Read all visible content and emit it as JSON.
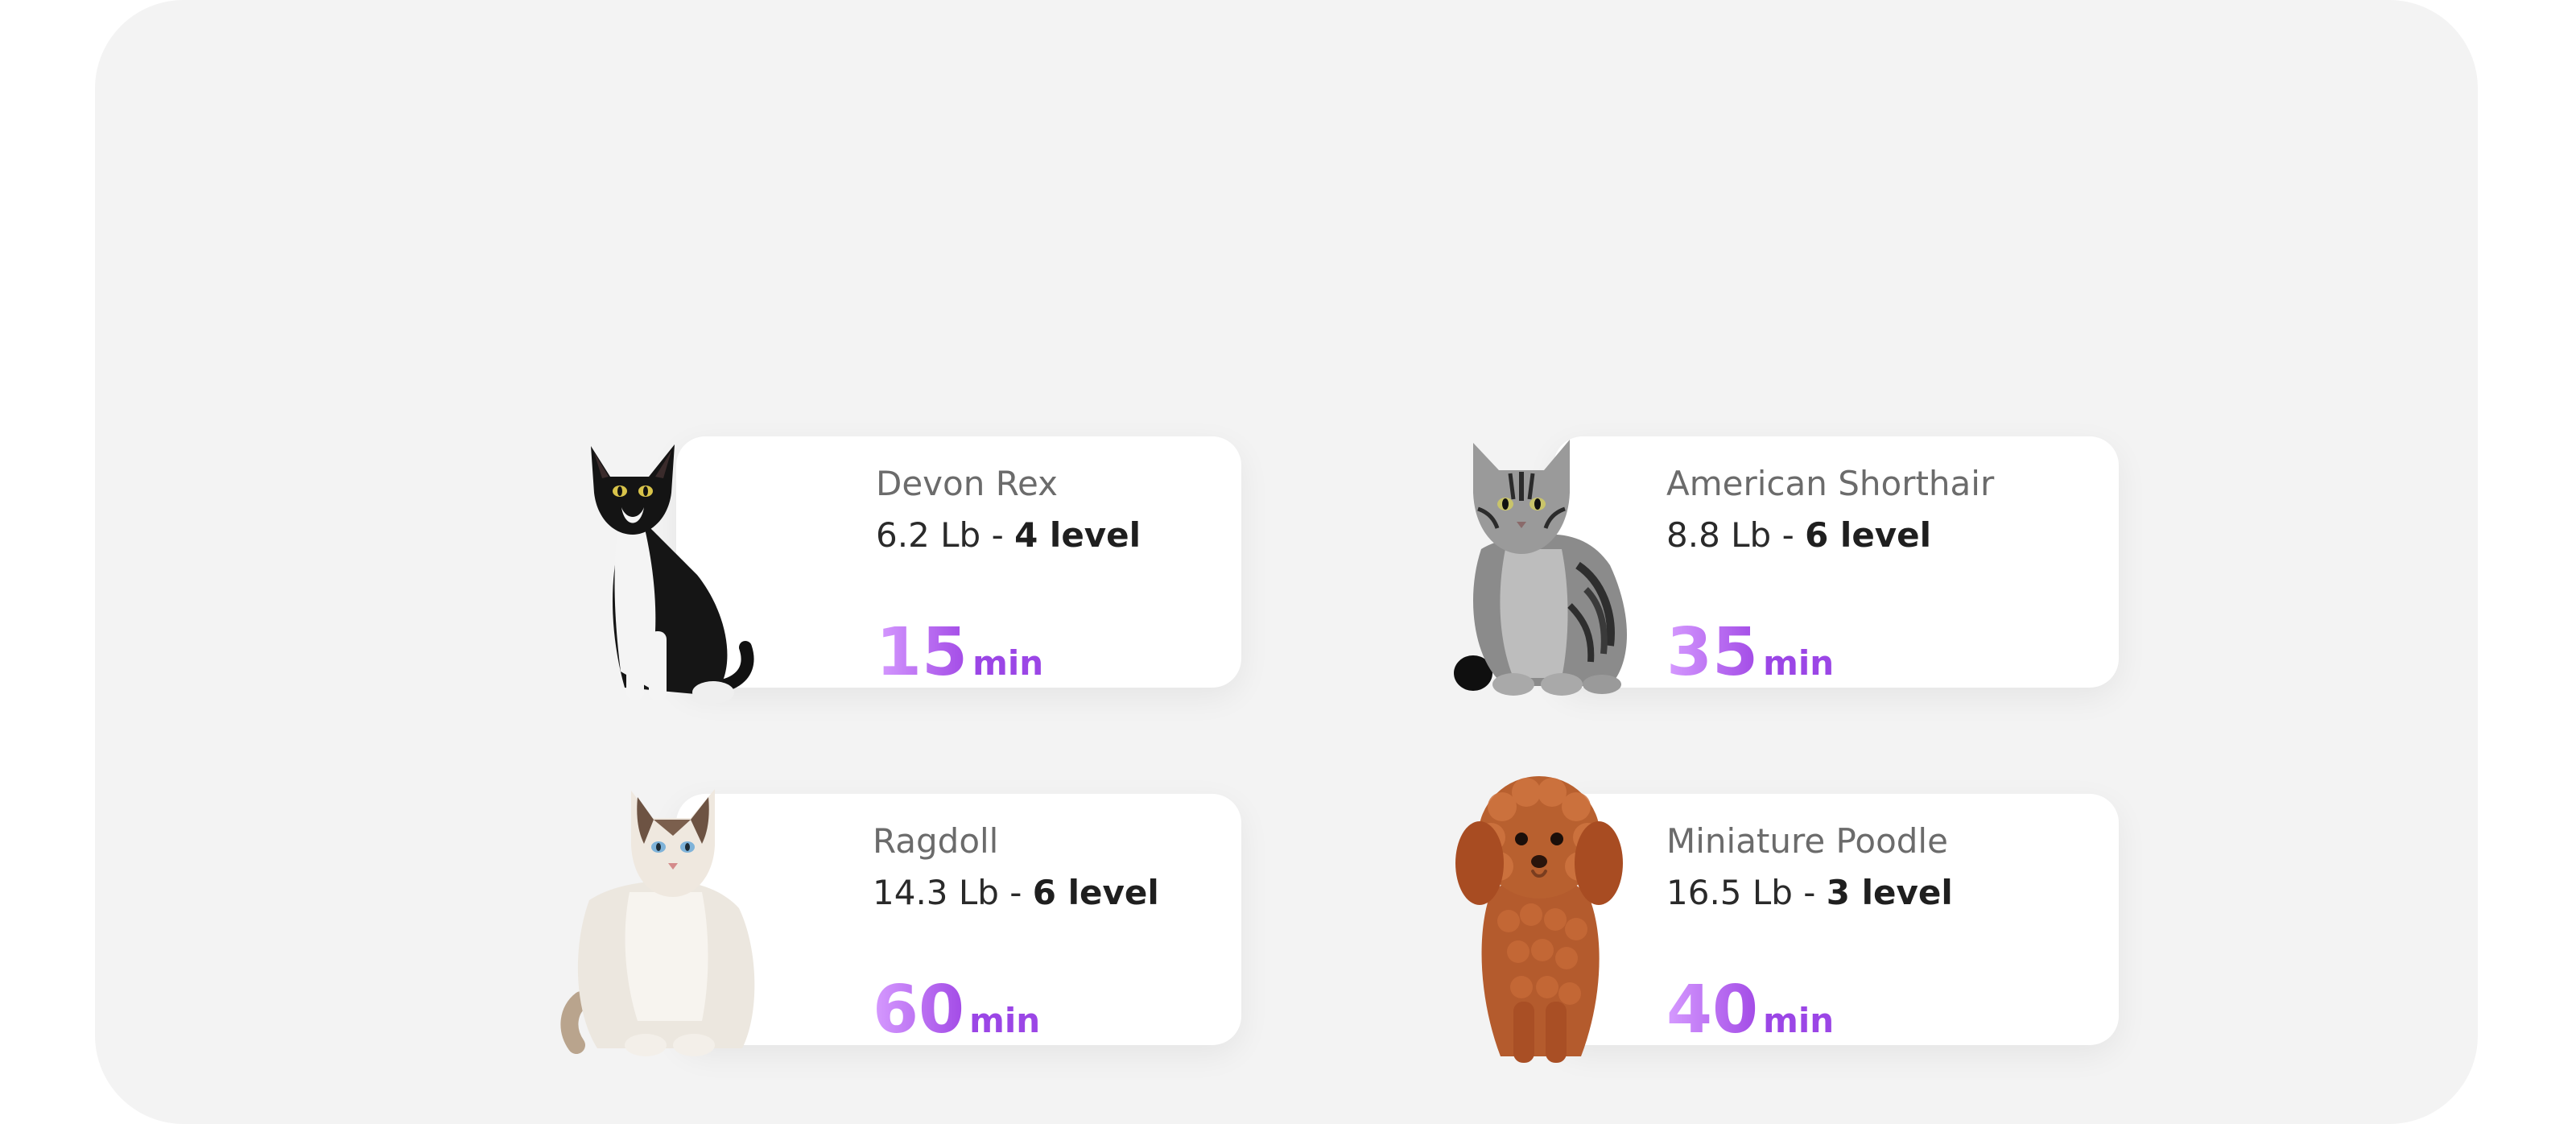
{
  "pets": [
    {
      "id": "devon-rex",
      "name": "Devon Rex",
      "weight": "6.2 Lb",
      "separator": " - ",
      "level": "4 level",
      "duration_value": "15",
      "duration_unit": "min"
    },
    {
      "id": "american-shorthair",
      "name": "American Shorthair",
      "weight": "8.8 Lb",
      "separator": " - ",
      "level": "6 level",
      "duration_value": "35",
      "duration_unit": "min"
    },
    {
      "id": "ragdoll",
      "name": "Ragdoll",
      "weight": "14.3 Lb",
      "separator": " - ",
      "level": "6 level",
      "duration_value": "60",
      "duration_unit": "min"
    },
    {
      "id": "miniature-poodle",
      "name": "Miniature Poodle",
      "weight": "16.5 Lb",
      "separator": " - ",
      "level": "3 level",
      "duration_value": "40",
      "duration_unit": "min"
    }
  ],
  "colors": {
    "panel_background": "#f3f3f3",
    "card_background": "#ffffff",
    "duration_gradient_start": "#d69bff",
    "duration_gradient_end": "#a24ae6"
  }
}
